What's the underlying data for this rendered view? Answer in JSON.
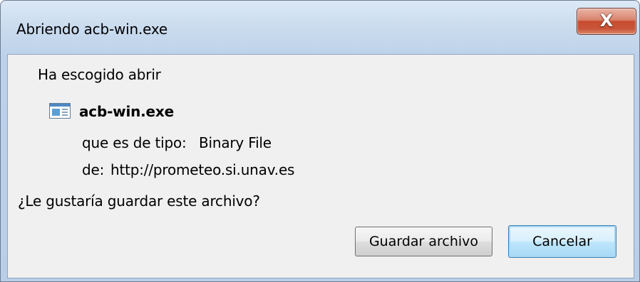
{
  "window": {
    "title": "Abriendo acb-win.exe",
    "close_glyph": "X",
    "close_icon": "close-icon"
  },
  "dialog": {
    "intro": "Ha escogido abrir",
    "file_icon": "file-icon",
    "file_name": "acb-win.exe",
    "type_label": "que es de tipo:",
    "type_value": "Binary File",
    "from_label": "de:",
    "from_value": "http://prometeo.si.unav.es",
    "question": "¿Le gustaría guardar este archivo?"
  },
  "buttons": {
    "save_label": "Guardar archivo",
    "cancel_label": "Cancelar"
  },
  "colors": {
    "close_accent": "#c74c2e",
    "focus_accent": "#3c7fb1"
  }
}
